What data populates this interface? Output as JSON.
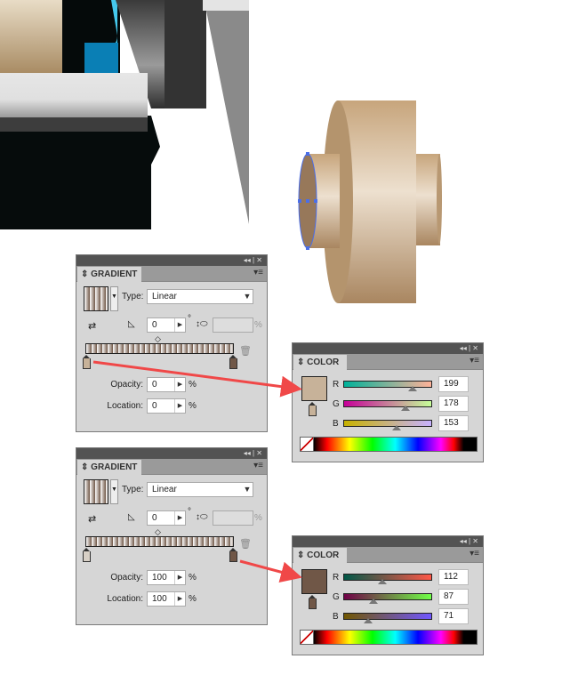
{
  "gradient_panels": [
    {
      "title": "GRADIENT",
      "type_label": "Type:",
      "type_value": "Linear",
      "angle": "0",
      "degree": "°",
      "percent": "%",
      "opacity_label": "Opacity:",
      "opacity": "0",
      "location_label": "Location:",
      "location": "0",
      "selected_stop": "left"
    },
    {
      "title": "GRADIENT",
      "type_label": "Type:",
      "type_value": "Linear",
      "angle": "0",
      "degree": "°",
      "percent": "%",
      "opacity_label": "Opacity:",
      "opacity": "100",
      "location_label": "Location:",
      "location": "100",
      "selected_stop": "right"
    }
  ],
  "color_panels": [
    {
      "title": "COLOR",
      "r_label": "R",
      "g_label": "G",
      "b_label": "B",
      "r": "199",
      "g": "178",
      "b": "153",
      "swatch": "#c7b299"
    },
    {
      "title": "COLOR",
      "r_label": "R",
      "g_label": "G",
      "b_label": "B",
      "r": "112",
      "g": "87",
      "b": "71",
      "swatch": "#705747"
    }
  ],
  "panel_controls": {
    "collapse": "◂◂",
    "close": "✕",
    "menu": "▾≡"
  },
  "colors": {
    "arrow": "#f04848",
    "gradient_start": "#c7b299",
    "gradient_end": "#705747"
  }
}
